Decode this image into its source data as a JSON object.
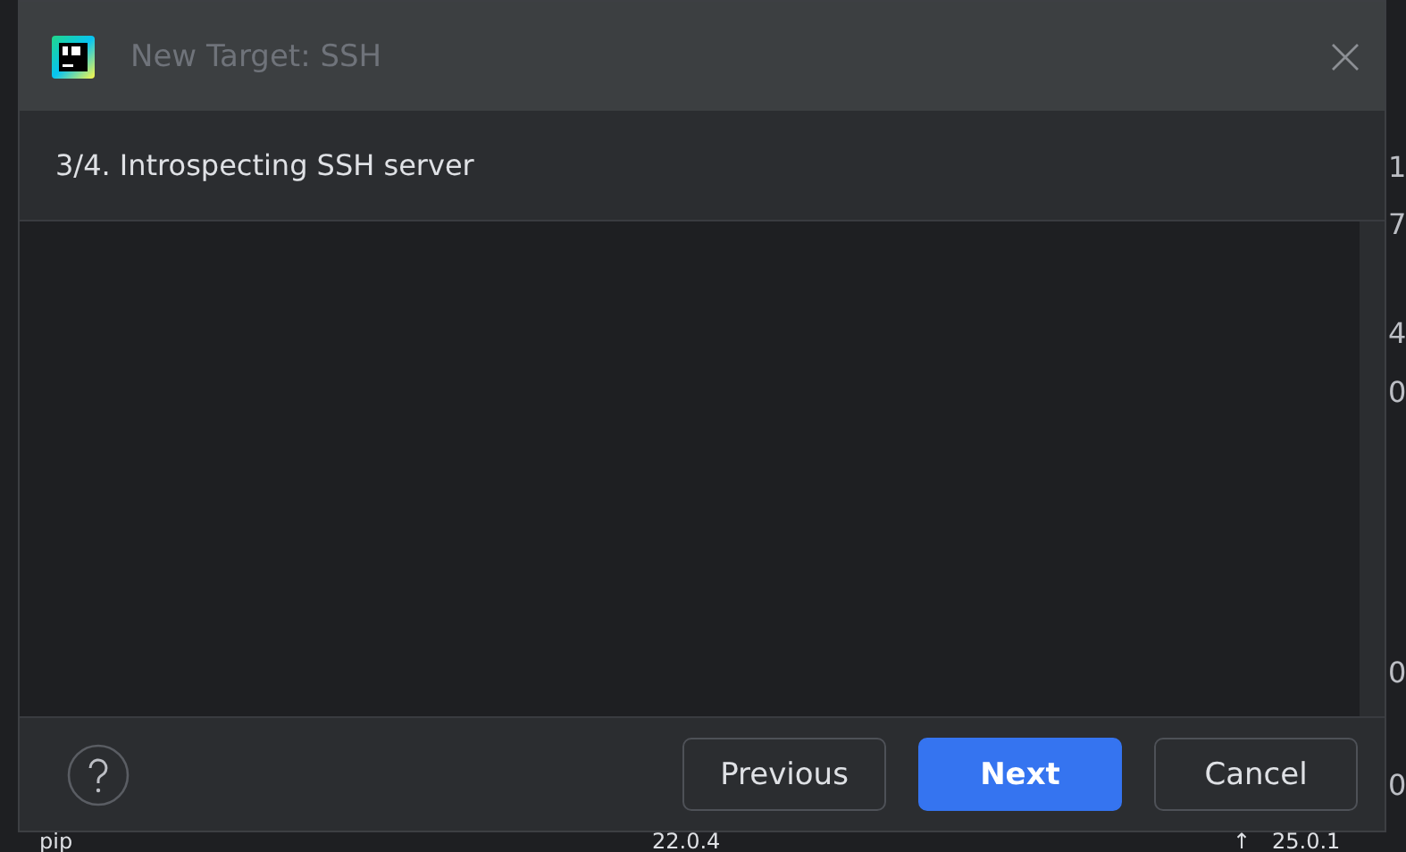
{
  "background": {
    "edge_fragments": [
      "1",
      "7",
      "4",
      "0",
      "0",
      "0"
    ],
    "row": {
      "name": "pip",
      "version": "22.0.4",
      "upgrade_icon": "↑",
      "latest": "25.0.1"
    }
  },
  "dialog": {
    "title": "New Target: SSH",
    "step": "3/4. Introspecting SSH server",
    "buttons": [
      {
        "label": "Previous",
        "kind": "secondary"
      },
      {
        "label": "Next",
        "kind": "primary"
      },
      {
        "label": "Cancel",
        "kind": "secondary"
      }
    ]
  }
}
